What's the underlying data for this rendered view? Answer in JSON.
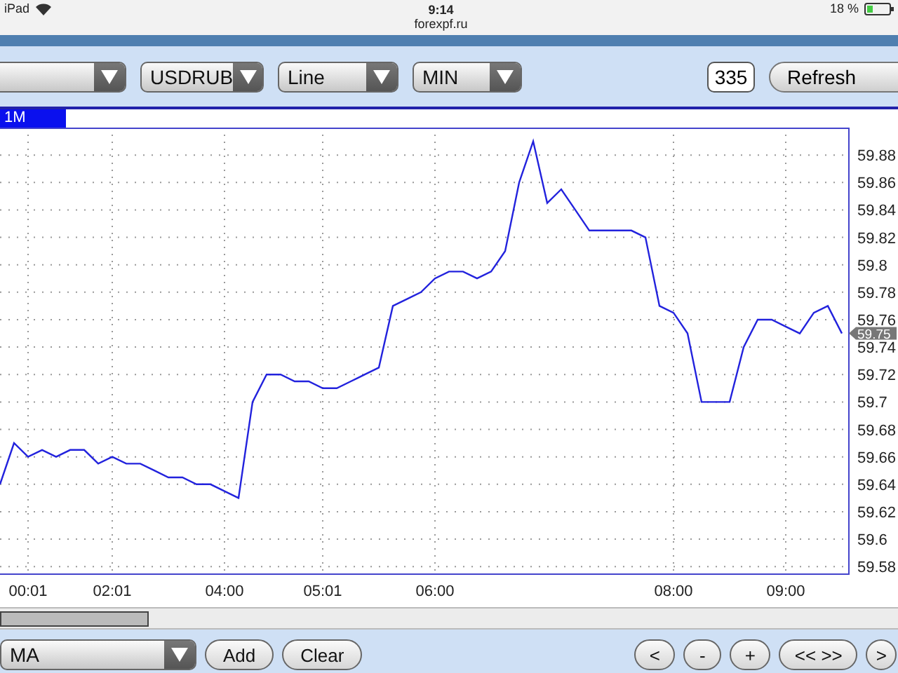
{
  "status_bar": {
    "device": "iPad",
    "time": "9:14",
    "url": "forexpf.ru",
    "battery": "18 %"
  },
  "toolbar": {
    "dropdowns": [
      {
        "value": "USDRUB"
      },
      {
        "value": "Line"
      },
      {
        "value": "MIN"
      }
    ],
    "count_field": {
      "value": "335"
    },
    "refresh_button": "Refresh"
  },
  "period_tab": {
    "label": "1M",
    "selected": true
  },
  "chart": {
    "chart_data": {
      "type": "line",
      "grid": true,
      "ylim": [
        59.575,
        59.9
      ],
      "categories": [
        null,
        null,
        "00:01",
        null,
        null,
        null,
        null,
        null,
        "02:01",
        null,
        null,
        null,
        null,
        null,
        null,
        null,
        "04:00",
        null,
        null,
        null,
        null,
        null,
        null,
        "05:01",
        null,
        null,
        null,
        null,
        null,
        null,
        null,
        "06:00",
        null,
        null,
        null,
        null,
        null,
        null,
        null,
        null,
        null,
        null,
        null,
        null,
        null,
        null,
        null,
        null,
        "08:00",
        null,
        null,
        null,
        null,
        null,
        null,
        null,
        "09:00",
        null,
        null,
        null,
        null
      ],
      "yticks": [
        59.58,
        59.6,
        59.62,
        59.64,
        59.66,
        59.68,
        59.7,
        59.72,
        59.74,
        59.76,
        59.78,
        59.8,
        59.82,
        59.84,
        59.86,
        59.88
      ],
      "series": [
        {
          "color": "#2222dd",
          "values": [
            59.64,
            59.67,
            59.66,
            59.665,
            59.66,
            59.665,
            59.665,
            59.655,
            59.66,
            59.655,
            59.655,
            59.65,
            59.645,
            59.645,
            59.64,
            59.64,
            59.635,
            59.63,
            59.7,
            59.72,
            59.72,
            59.715,
            59.715,
            59.71,
            59.71,
            59.715,
            59.72,
            59.725,
            59.77,
            59.775,
            59.78,
            59.79,
            59.795,
            59.795,
            59.79,
            59.795,
            59.81,
            59.86,
            59.89,
            59.845,
            59.855,
            59.84,
            59.825,
            59.825,
            59.825,
            59.825,
            59.82,
            59.77,
            59.765,
            59.75,
            59.7,
            59.7,
            59.7,
            59.74,
            59.76,
            59.76,
            59.755,
            59.75,
            59.765,
            59.77,
            59.75
          ]
        }
      ],
      "annotations": [
        "59.75"
      ]
    }
  },
  "bottom_bar": {
    "indicator_dropdown": {
      "value": "MA"
    },
    "buttons": [
      "Add",
      "Clear"
    ],
    "nav_buttons": [
      "<",
      "-",
      "+",
      "<< >>",
      ">"
    ]
  }
}
